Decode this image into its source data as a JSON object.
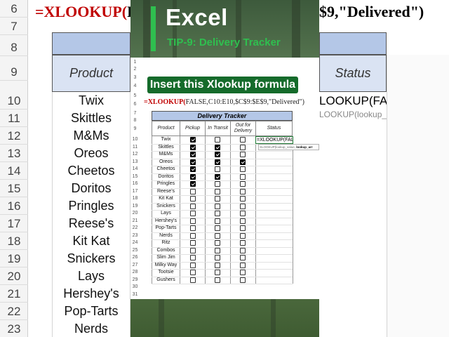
{
  "background_sheet": {
    "row_numbers": [
      "6",
      "7",
      "8",
      "9",
      "10",
      "11",
      "12",
      "13",
      "14",
      "15",
      "16",
      "17",
      "18",
      "19",
      "20",
      "21",
      "22",
      "23"
    ],
    "formula_fn": "=XLOOKUP(",
    "formula_arg": "F",
    "formula_tail": "$9,\"Delivered\")",
    "product_header": "Product",
    "status_header": "Status",
    "products": [
      "Twix",
      "Skittles",
      "M&Ms",
      "Oreos",
      "Cheetos",
      "Doritos",
      "Pringles",
      "Reese's",
      "Kit Kat",
      "Snickers",
      "Lays",
      "Hershey's",
      "Pop-Tarts",
      "Nerds"
    ],
    "status_cell": "LOOKUP(FALSE,",
    "tooltip_prefix": "LOOKUP(lookup_value, ",
    "tooltip_bold": "lookup_arra"
  },
  "overlay": {
    "app_title": "Excel",
    "tip_title": "TIP-9: Delivery Tracker",
    "callout": "Insert this Xlookup formula",
    "formula_fn": "=XLOOKUP(",
    "formula_args": "FALSE,C10:E10,$C$9:$E$9,\"Delivered\")"
  },
  "sheet": {
    "row_numbers": [
      "1",
      "2",
      "3",
      "4",
      "5",
      "6",
      "7",
      "8",
      "9",
      "10",
      "11",
      "12",
      "13",
      "14",
      "15",
      "16",
      "17",
      "18",
      "19",
      "20",
      "21",
      "22",
      "23",
      "24",
      "25",
      "26",
      "27",
      "28",
      "29",
      "30",
      "31"
    ],
    "table_title": "Delivery Tracker",
    "headers": [
      "Product",
      "Pickup",
      "In Transit",
      "Out for Delivery",
      "Status"
    ],
    "status_edit": "=XLOOKUP(FALSE,",
    "tooltip_prefix": "XLOOKUP(lookup_value, ",
    "tooltip_bold": "lookup_arr",
    "rows": [
      {
        "product": "Twix",
        "pickup": true,
        "transit": false,
        "delivery": false
      },
      {
        "product": "Skittles",
        "pickup": true,
        "transit": true,
        "delivery": false
      },
      {
        "product": "M&Ms",
        "pickup": true,
        "transit": true,
        "delivery": false
      },
      {
        "product": "Oreos",
        "pickup": true,
        "transit": true,
        "delivery": true
      },
      {
        "product": "Cheetos",
        "pickup": true,
        "transit": false,
        "delivery": false
      },
      {
        "product": "Doritos",
        "pickup": true,
        "transit": true,
        "delivery": false
      },
      {
        "product": "Pringles",
        "pickup": true,
        "transit": false,
        "delivery": false
      },
      {
        "product": "Reese's",
        "pickup": false,
        "transit": false,
        "delivery": false
      },
      {
        "product": "Kit Kat",
        "pickup": false,
        "transit": false,
        "delivery": false
      },
      {
        "product": "Snickers",
        "pickup": false,
        "transit": false,
        "delivery": false
      },
      {
        "product": "Lays",
        "pickup": false,
        "transit": false,
        "delivery": false
      },
      {
        "product": "Hershey's",
        "pickup": false,
        "transit": false,
        "delivery": false
      },
      {
        "product": "Pop-Tarts",
        "pickup": false,
        "transit": false,
        "delivery": false
      },
      {
        "product": "Nerds",
        "pickup": false,
        "transit": false,
        "delivery": false
      },
      {
        "product": "Ritz",
        "pickup": false,
        "transit": false,
        "delivery": false
      },
      {
        "product": "Combos",
        "pickup": false,
        "transit": false,
        "delivery": false
      },
      {
        "product": "Slim Jim",
        "pickup": false,
        "transit": false,
        "delivery": false
      },
      {
        "product": "Milky Way",
        "pickup": false,
        "transit": false,
        "delivery": false
      },
      {
        "product": "Tootsie",
        "pickup": false,
        "transit": false,
        "delivery": false
      },
      {
        "product": "Gushers",
        "pickup": false,
        "transit": false,
        "delivery": false
      }
    ]
  }
}
